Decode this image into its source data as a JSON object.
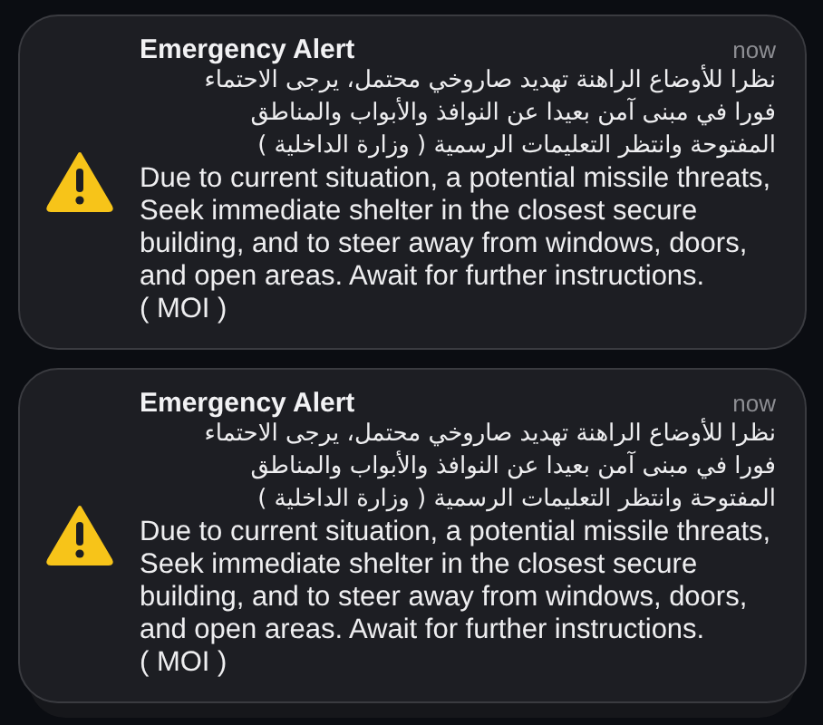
{
  "notifications": [
    {
      "title": "Emergency Alert",
      "time": "now",
      "body_arabic": "نظرا للأوضاع الراهنة تهديد صاروخي محتمل، يرجى الاحتماء\nفورا في مبنى آمن بعيدا عن النوافذ والأبواب والمناطق\nالمفتوحة وانتظر التعليمات الرسمية ( وزارة الداخلية )",
      "body_english": "Due to current situation, a potential missile threats,\nSeek immediate shelter in the closest secure\nbuilding, and to steer away from windows, doors,\nand open areas. Await for further instructions.\n( MOI  )"
    },
    {
      "title": "Emergency Alert",
      "time": "now",
      "body_arabic": "نظرا للأوضاع الراهنة تهديد صاروخي محتمل، يرجى الاحتماء\nفورا في مبنى آمن بعيدا عن النوافذ والأبواب والمناطق\nالمفتوحة وانتظر التعليمات الرسمية ( وزارة الداخلية )",
      "body_english": "Due to current situation, a potential missile threats,\nSeek immediate shelter in the closest secure\nbuilding, and to steer away from windows, doors,\nand open areas. Await for further instructions.\n( MOI  )"
    }
  ]
}
